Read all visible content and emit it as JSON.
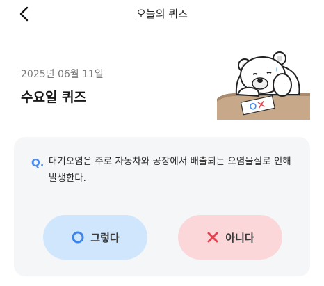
{
  "header": {
    "title": "오늘의 퀴즈",
    "back_icon": "chevron-left-icon"
  },
  "quiz": {
    "date": "2025년 06월 11일",
    "title": "수요일 퀴즈"
  },
  "illustration": {
    "name": "bear-ox-quiz-illustration",
    "board_text": "OX"
  },
  "question": {
    "label": "Q.",
    "text": "대기오염은 주로 자동차와 공장에서 배출되는 오염물질로 인해 발생한다."
  },
  "answers": {
    "yes_label": "그렇다",
    "yes_icon": "circle-o-icon",
    "no_label": "아니다",
    "no_icon": "x-icon"
  },
  "colors": {
    "accent_blue": "#4a8df0",
    "yes_bg": "#cfe6fd",
    "no_bg": "#fbd7da",
    "no_red": "#e5424f",
    "card_bg": "#f5f6f8"
  }
}
